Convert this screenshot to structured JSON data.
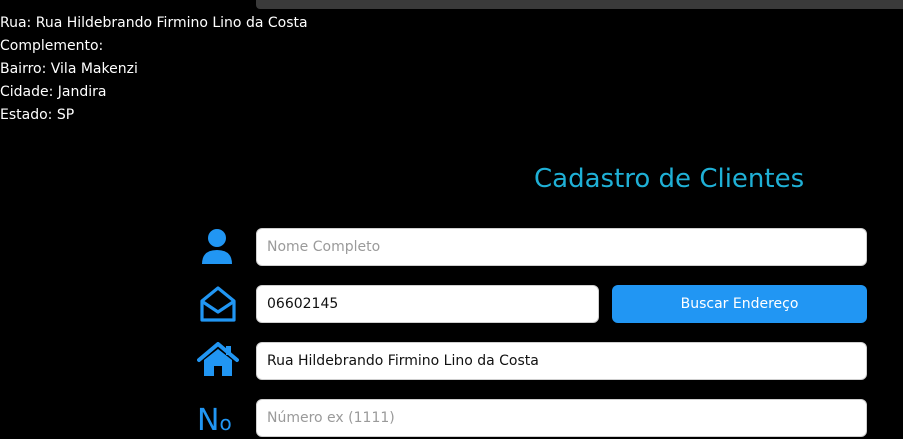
{
  "address_info": {
    "rua": "Rua: Rua Hildebrando Firmino Lino da Costa",
    "complemento": "Complemento:",
    "bairro": "Bairro: Vila Makenzi",
    "cidade": "Cidade: Jandira",
    "estado": "Estado: SP"
  },
  "form": {
    "title": "Cadastro de Clientes",
    "nome": {
      "placeholder": "Nome Completo",
      "value": ""
    },
    "cep": {
      "value": "06602145"
    },
    "buscar_label": "Buscar Endereço",
    "endereco": {
      "value": "Rua Hildebrando Firmino Lino da Costa"
    },
    "numero": {
      "placeholder": "Número ex (1111)",
      "value": ""
    },
    "numero_icon_text": "N",
    "numero_icon_sup": "o"
  },
  "icons": {
    "nome": "user-icon",
    "cep": "envelope-open-icon",
    "endereco": "home-icon",
    "numero": "number-icon"
  },
  "colors": {
    "accent": "#2196f3",
    "title": "#1fb0d6",
    "background": "#000000"
  }
}
